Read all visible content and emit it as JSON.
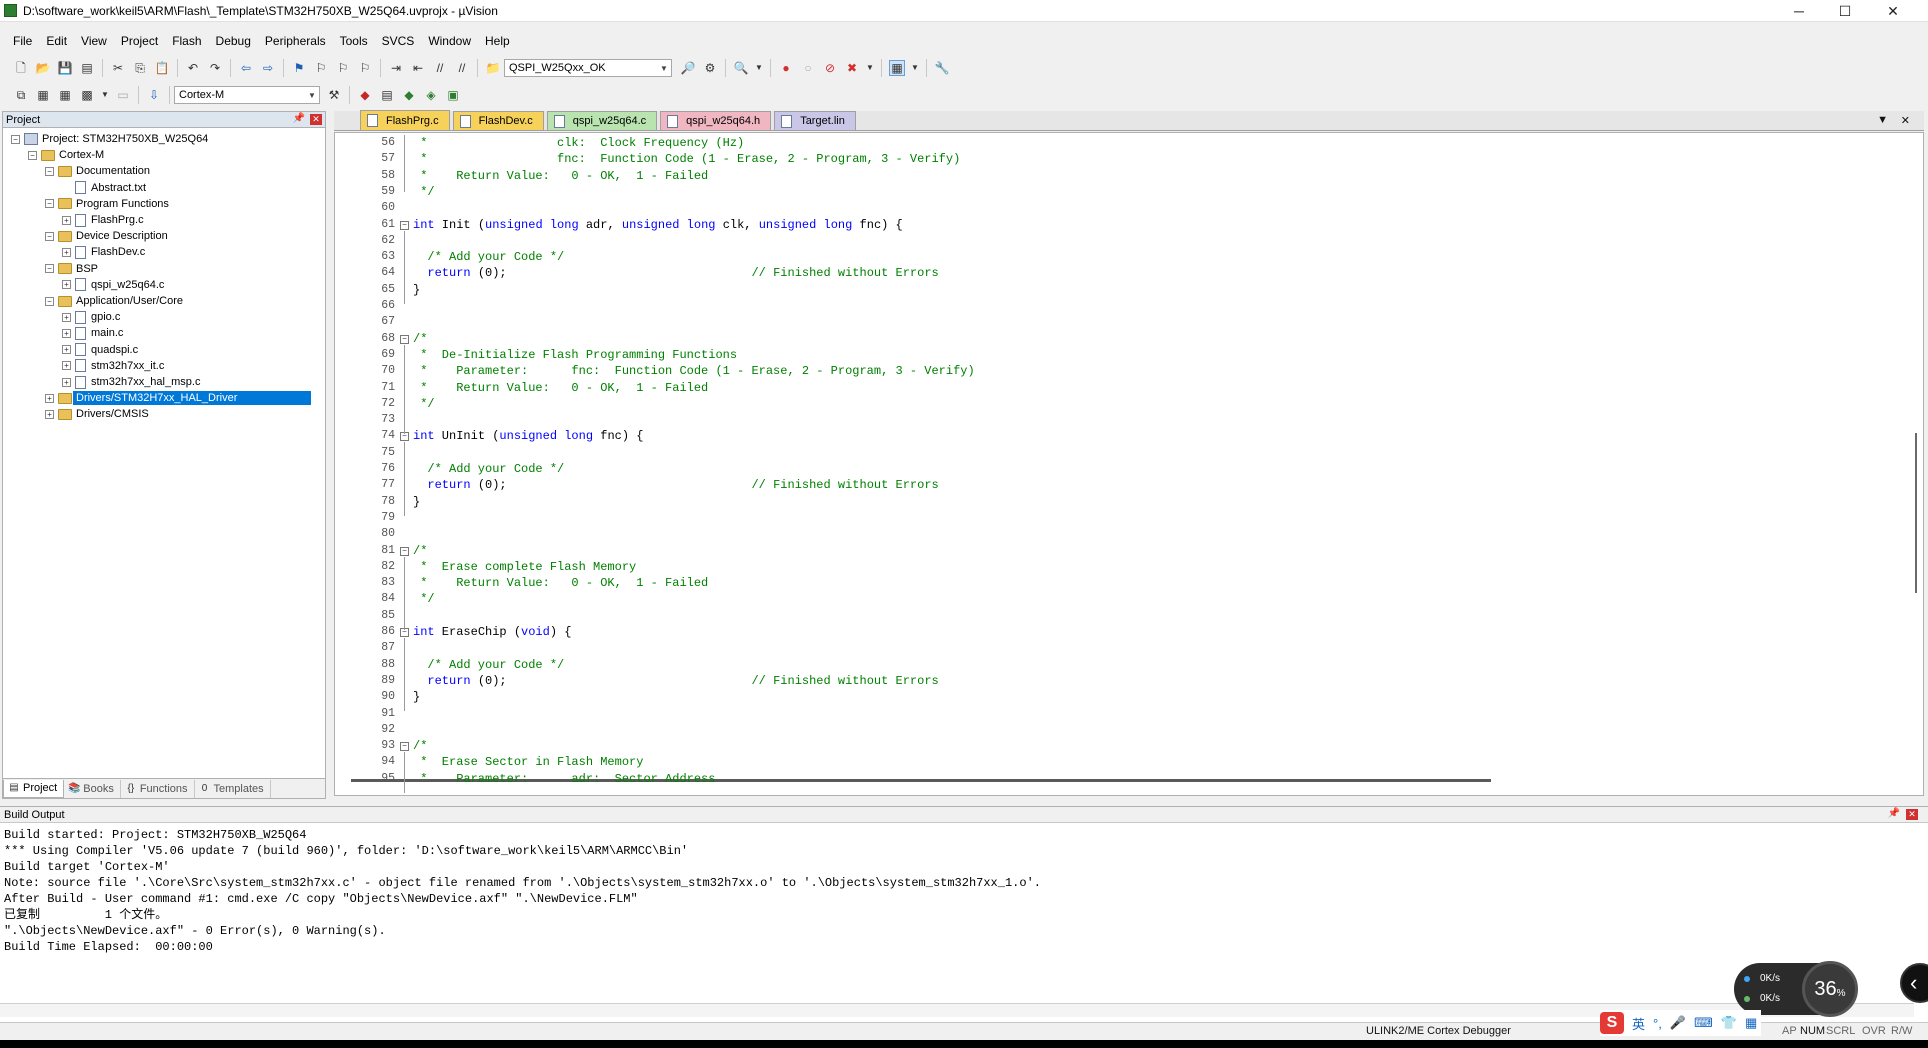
{
  "window": {
    "title": "D:\\software_work\\keil5\\ARM\\Flash\\_Template\\STM32H750XB_W25Q64.uvprojx - µVision",
    "minimize": "─",
    "maximize": "☐",
    "close": "✕"
  },
  "menu": [
    "File",
    "Edit",
    "View",
    "Project",
    "Flash",
    "Debug",
    "Peripherals",
    "Tools",
    "SVCS",
    "Window",
    "Help"
  ],
  "toolbar": {
    "find_combo": "QSPI_W25Qxx_OK",
    "target_combo": "Cortex-M"
  },
  "project_panel": {
    "title": "Project",
    "tree": [
      {
        "label": "Project: STM32H750XB_W25Q64",
        "type": "project",
        "toggle": "−"
      },
      {
        "label": "Cortex-M",
        "type": "folder",
        "toggle": "−"
      },
      {
        "label": "Documentation",
        "type": "folder",
        "toggle": "−"
      },
      {
        "label": "Abstract.txt",
        "type": "file",
        "toggle": ""
      },
      {
        "label": "Program Functions",
        "type": "folder",
        "toggle": "−"
      },
      {
        "label": "FlashPrg.c",
        "type": "file",
        "toggle": "+"
      },
      {
        "label": "Device Description",
        "type": "folder",
        "toggle": "−"
      },
      {
        "label": "FlashDev.c",
        "type": "file",
        "toggle": "+"
      },
      {
        "label": "BSP",
        "type": "folder",
        "toggle": "−"
      },
      {
        "label": "qspi_w25q64.c",
        "type": "file",
        "toggle": "+"
      },
      {
        "label": "Application/User/Core",
        "type": "folder",
        "toggle": "−"
      },
      {
        "label": "gpio.c",
        "type": "file",
        "toggle": "+"
      },
      {
        "label": "main.c",
        "type": "file",
        "toggle": "+"
      },
      {
        "label": "quadspi.c",
        "type": "file",
        "toggle": "+"
      },
      {
        "label": "stm32h7xx_it.c",
        "type": "file",
        "toggle": "+"
      },
      {
        "label": "stm32h7xx_hal_msp.c",
        "type": "file",
        "toggle": "+"
      },
      {
        "label": "Drivers/STM32H7xx_HAL_Driver",
        "type": "folder",
        "toggle": "+",
        "selected": true
      },
      {
        "label": "Drivers/CMSIS",
        "type": "folder",
        "toggle": "+"
      }
    ],
    "tabs": [
      "Project",
      "Books",
      "Functions",
      "Templates"
    ]
  },
  "editor": {
    "tabs": [
      {
        "label": "FlashPrg.c",
        "color": "#f6d25a",
        "active": true
      },
      {
        "label": "FlashDev.c",
        "color": "#f6d25a"
      },
      {
        "label": "qspi_w25q64.c",
        "color": "#b9e4b0"
      },
      {
        "label": "qspi_w25q64.h",
        "color": "#f0b6c2"
      },
      {
        "label": "Target.lin",
        "color": "#c9c6e8"
      }
    ],
    "lines": [
      {
        "n": "56",
        "t": [
          [
            "c",
            " *                  clk:  Clock Frequency (Hz)"
          ]
        ]
      },
      {
        "n": "57",
        "t": [
          [
            "c",
            " *                  fnc:  Function Code (1 - Erase, 2 - Program, 3 - Verify)"
          ]
        ]
      },
      {
        "n": "58",
        "t": [
          [
            "c",
            " *    Return Value:   0 - OK,  1 - Failed"
          ]
        ]
      },
      {
        "n": "59",
        "t": [
          [
            "c",
            " */"
          ]
        ]
      },
      {
        "n": "60",
        "t": []
      },
      {
        "n": "61",
        "fold": true,
        "t": [
          [
            "k",
            "int"
          ],
          [
            "",
            " Init ("
          ],
          [
            "k",
            "unsigned long"
          ],
          [
            "",
            " adr, "
          ],
          [
            "k",
            "unsigned long"
          ],
          [
            "",
            " clk, "
          ],
          [
            "k",
            "unsigned long"
          ],
          [
            "",
            " fnc) {"
          ]
        ]
      },
      {
        "n": "62",
        "t": []
      },
      {
        "n": "63",
        "t": [
          [
            "c",
            "  /* Add your Code */"
          ]
        ]
      },
      {
        "n": "64",
        "t": [
          [
            "",
            "  "
          ],
          [
            "k",
            "return"
          ],
          [
            "",
            " (0);                                  "
          ],
          [
            "c",
            "// Finished without Errors"
          ]
        ]
      },
      {
        "n": "65",
        "t": [
          [
            "",
            "}"
          ]
        ]
      },
      {
        "n": "66",
        "t": []
      },
      {
        "n": "67",
        "t": []
      },
      {
        "n": "68",
        "fold": true,
        "t": [
          [
            "c",
            "/*"
          ]
        ]
      },
      {
        "n": "69",
        "t": [
          [
            "c",
            " *  De-Initialize Flash Programming Functions"
          ]
        ]
      },
      {
        "n": "70",
        "t": [
          [
            "c",
            " *    Parameter:      fnc:  Function Code (1 - Erase, 2 - Program, 3 - Verify)"
          ]
        ]
      },
      {
        "n": "71",
        "t": [
          [
            "c",
            " *    Return Value:   0 - OK,  1 - Failed"
          ]
        ]
      },
      {
        "n": "72",
        "t": [
          [
            "c",
            " */"
          ]
        ]
      },
      {
        "n": "73",
        "t": []
      },
      {
        "n": "74",
        "fold": true,
        "t": [
          [
            "k",
            "int"
          ],
          [
            "",
            " UnInit ("
          ],
          [
            "k",
            "unsigned long"
          ],
          [
            "",
            " fnc) {"
          ]
        ]
      },
      {
        "n": "75",
        "t": []
      },
      {
        "n": "76",
        "t": [
          [
            "c",
            "  /* Add your Code */"
          ]
        ]
      },
      {
        "n": "77",
        "t": [
          [
            "",
            "  "
          ],
          [
            "k",
            "return"
          ],
          [
            "",
            " (0);                                  "
          ],
          [
            "c",
            "// Finished without Errors"
          ]
        ]
      },
      {
        "n": "78",
        "t": [
          [
            "",
            "}"
          ]
        ]
      },
      {
        "n": "79",
        "t": []
      },
      {
        "n": "80",
        "t": []
      },
      {
        "n": "81",
        "fold": true,
        "t": [
          [
            "c",
            "/*"
          ]
        ]
      },
      {
        "n": "82",
        "t": [
          [
            "c",
            " *  Erase complete Flash Memory"
          ]
        ]
      },
      {
        "n": "83",
        "t": [
          [
            "c",
            " *    Return Value:   0 - OK,  1 - Failed"
          ]
        ]
      },
      {
        "n": "84",
        "t": [
          [
            "c",
            " */"
          ]
        ]
      },
      {
        "n": "85",
        "t": []
      },
      {
        "n": "86",
        "fold": true,
        "t": [
          [
            "k",
            "int"
          ],
          [
            "",
            " EraseChip ("
          ],
          [
            "k",
            "void"
          ],
          [
            "",
            ") {"
          ]
        ]
      },
      {
        "n": "87",
        "t": []
      },
      {
        "n": "88",
        "t": [
          [
            "c",
            "  /* Add your Code */"
          ]
        ]
      },
      {
        "n": "89",
        "t": [
          [
            "",
            "  "
          ],
          [
            "k",
            "return"
          ],
          [
            "",
            " (0);                                  "
          ],
          [
            "c",
            "// Finished without Errors"
          ]
        ]
      },
      {
        "n": "90",
        "t": [
          [
            "",
            "}"
          ]
        ]
      },
      {
        "n": "91",
        "t": []
      },
      {
        "n": "92",
        "t": []
      },
      {
        "n": "93",
        "fold": true,
        "t": [
          [
            "c",
            "/*"
          ]
        ]
      },
      {
        "n": "94",
        "t": [
          [
            "c",
            " *  Erase Sector in Flash Memory"
          ]
        ]
      },
      {
        "n": "95",
        "t": [
          [
            "c",
            " *    Parameter:      adr:  Sector Address"
          ]
        ]
      }
    ]
  },
  "build_output": {
    "title": "Build Output",
    "lines": [
      "Build started: Project: STM32H750XB_W25Q64",
      "*** Using Compiler 'V5.06 update 7 (build 960)', folder: 'D:\\software_work\\keil5\\ARM\\ARMCC\\Bin'",
      "Build target 'Cortex-M'",
      "Note: source file '.\\Core\\Src\\system_stm32h7xx.c' - object file renamed from '.\\Objects\\system_stm32h7xx.o' to '.\\Objects\\system_stm32h7xx_1.o'.",
      "After Build - User command #1: cmd.exe /C copy \"Objects\\NewDevice.axf\" \".\\NewDevice.FLM\"",
      "已复制         1 个文件。",
      "\".\\Objects\\NewDevice.axf\" - 0 Error(s), 0 Warning(s).",
      "Build Time Elapsed:  00:00:00"
    ]
  },
  "net_widget": {
    "up": "0K/s",
    "down": "0K/s",
    "cpu": "36",
    "cpu_unit": "%"
  },
  "statusbar": {
    "debugger": "ULINK2/ME Cortex Debugger",
    "indicators": [
      "AP",
      "NUM",
      "SCRL",
      "OVR",
      "R/W"
    ]
  },
  "ime": {
    "logo": "S",
    "lang": "英"
  }
}
